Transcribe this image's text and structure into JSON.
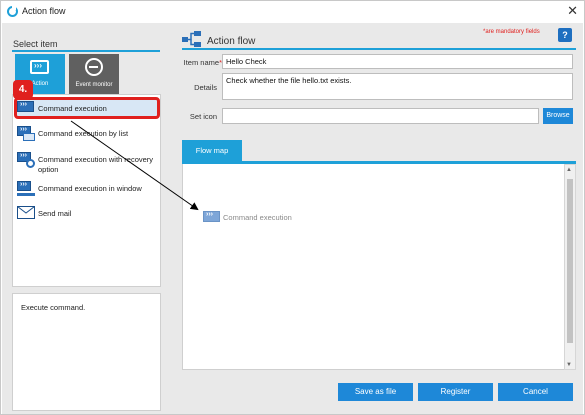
{
  "window": {
    "title": "Action flow",
    "close": "✕"
  },
  "left": {
    "select_label": "Select item",
    "tabs": [
      {
        "label": "Action",
        "icon": "command-window-icon"
      },
      {
        "label": "Event monitor",
        "icon": "heartbeat-monitor-icon"
      }
    ],
    "step_badge": "4.",
    "items": [
      {
        "label": "Command execution",
        "icon": "command-execution-icon",
        "selected": true
      },
      {
        "label": "Command execution by list",
        "icon": "command-list-icon"
      },
      {
        "label": "Command execution with recovery option",
        "icon": "command-recovery-icon"
      },
      {
        "label": "Command execution in window",
        "icon": "command-window-icon"
      },
      {
        "label": "Send mail",
        "icon": "mail-icon"
      }
    ],
    "description": "Execute command."
  },
  "right": {
    "title": "Action flow",
    "mandatory_note": "*are mandatory fields",
    "help": "?",
    "fields": {
      "item_name_label": "Item name",
      "item_name_req": "*",
      "item_name_value": "Hello Check",
      "details_label": "Details",
      "details_value": "Check whether the file hello.txt exists.",
      "set_icon_label": "Set icon",
      "set_icon_value": "",
      "browse": "Browse"
    },
    "flow_map": {
      "tab_label": "Flow map",
      "node_label": "Command execution"
    },
    "buttons": {
      "save_as_file": "Save as file",
      "register": "Register",
      "cancel": "Cancel"
    }
  },
  "colors": {
    "accent": "#1ea0d8",
    "button": "#1e88d8",
    "highlight": "#e0201e"
  }
}
